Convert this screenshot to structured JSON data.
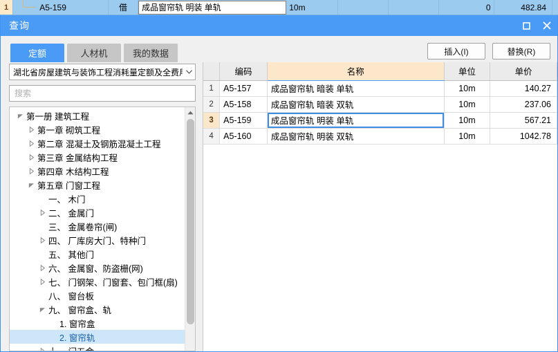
{
  "background_row": {
    "row_number": "1",
    "code": "A5-159",
    "kind": "借",
    "name": "成品窗帘轨 明装 单轨",
    "unit": "10m",
    "blank1": "",
    "blank2": "",
    "quantity": "0",
    "price": "482.84"
  },
  "dialog": {
    "title": "查询",
    "window_buttons": {
      "maximize": "maximize-icon",
      "close": "close-icon"
    },
    "tabs": [
      {
        "label": "定额",
        "active": true
      },
      {
        "label": "人材机",
        "active": false
      },
      {
        "label": "我的数据",
        "active": false
      }
    ],
    "actions": [
      {
        "label": "插入(I)"
      },
      {
        "label": "替换(R)"
      }
    ],
    "left": {
      "library_select": {
        "value": "湖北省房屋建筑与装饰工程消耗量定额及全费用",
        "arrow": "chevron-down-icon"
      },
      "search": {
        "value": "",
        "placeholder": "搜索"
      },
      "tree": [
        {
          "label": "第一册 建筑工程",
          "indent": 0,
          "state": "expanded"
        },
        {
          "label": "第一章 砌筑工程",
          "indent": 1,
          "state": "collapsed"
        },
        {
          "label": "第二章 混凝土及钢筋混凝土工程",
          "indent": 1,
          "state": "collapsed"
        },
        {
          "label": "第三章 金属结构工程",
          "indent": 1,
          "state": "collapsed"
        },
        {
          "label": "第四章 木结构工程",
          "indent": 1,
          "state": "collapsed"
        },
        {
          "label": "第五章 门窗工程",
          "indent": 1,
          "state": "expanded"
        },
        {
          "label": "一、 木门",
          "indent": 2,
          "state": "leaf"
        },
        {
          "label": "二、 金属门",
          "indent": 2,
          "state": "collapsed"
        },
        {
          "label": "三、 金属卷帘(闸)",
          "indent": 2,
          "state": "leaf"
        },
        {
          "label": "四、 厂库房大门、特种门",
          "indent": 2,
          "state": "collapsed"
        },
        {
          "label": "五、 其他门",
          "indent": 2,
          "state": "leaf"
        },
        {
          "label": "六、 金属窗、防盗栅(网)",
          "indent": 2,
          "state": "collapsed"
        },
        {
          "label": "七、 门钢架、门窗套、包门框(扇)",
          "indent": 2,
          "state": "collapsed"
        },
        {
          "label": "八、 窗台板",
          "indent": 2,
          "state": "leaf"
        },
        {
          "label": "九、 窗帘盒、轨",
          "indent": 2,
          "state": "expanded"
        },
        {
          "label": "1. 窗帘盒",
          "indent": 3,
          "state": "leaf"
        },
        {
          "label": "2. 窗帘轨",
          "indent": 3,
          "state": "leaf",
          "selected": true
        },
        {
          "label": "十、 门五金",
          "indent": 2,
          "state": "collapsed"
        }
      ],
      "scrollbar": {
        "up_arrow": "caret-up-icon"
      }
    },
    "grid": {
      "columns": [
        {
          "key": "rn",
          "label": ""
        },
        {
          "key": "code",
          "label": "编码"
        },
        {
          "key": "name",
          "label": "名称",
          "highlight": true
        },
        {
          "key": "unit",
          "label": "单位"
        },
        {
          "key": "price",
          "label": "单价"
        }
      ],
      "rows": [
        {
          "rn": "1",
          "code": "A5-157",
          "name": "成品窗帘轨 暗装 单轨",
          "unit": "10m",
          "price": "140.27",
          "selected": false
        },
        {
          "rn": "2",
          "code": "A5-158",
          "name": "成品窗帘轨 暗装 双轨",
          "unit": "10m",
          "price": "237.06",
          "selected": false
        },
        {
          "rn": "3",
          "code": "A5-159",
          "name": "成品窗帘轨 明装 单轨",
          "unit": "10m",
          "price": "567.21",
          "selected": true
        },
        {
          "rn": "4",
          "code": "A5-160",
          "name": "成品窗帘轨 明装 双轨",
          "unit": "10m",
          "price": "1042.78",
          "selected": false
        }
      ]
    }
  },
  "colors": {
    "accent": "#4a9bf5",
    "selection_blue": "#cde6fa",
    "highlight_peach": "#fde7cb",
    "bg_row_blue": "#9ccbf0"
  }
}
